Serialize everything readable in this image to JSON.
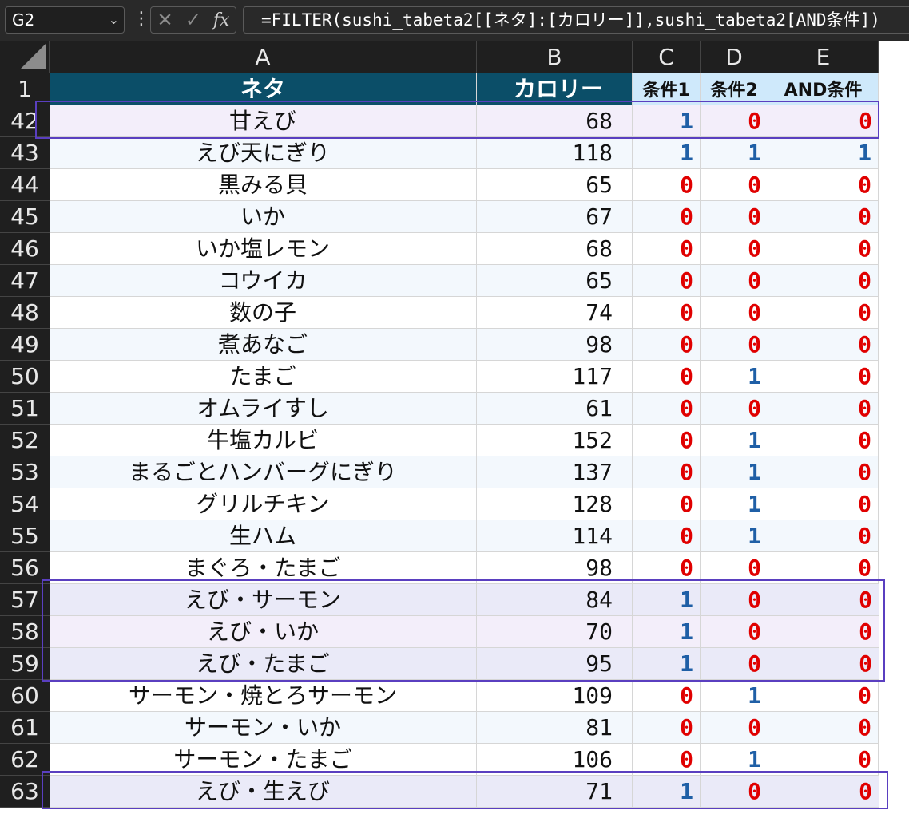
{
  "formula_bar": {
    "name_box": "G2",
    "chevron": "⌄",
    "dots": "⋮",
    "cancel_icon": "✕",
    "enter_icon": "✓",
    "fx_icon": "fx",
    "formula": "=FILTER(sushi_tabeta2[[ネタ]:[カロリー]],sushi_tabeta2[AND条件])"
  },
  "columns": [
    "A",
    "B",
    "C",
    "D",
    "E"
  ],
  "header_row": {
    "row_number": "1",
    "cells": [
      "ネタ",
      "カロリー",
      "条件1",
      "条件2",
      "AND条件"
    ]
  },
  "rows": [
    {
      "row": "42",
      "name": "甘えび",
      "cal": "68",
      "c1": "1",
      "c2": "0",
      "and": "0"
    },
    {
      "row": "43",
      "name": "えび天にぎり",
      "cal": "118",
      "c1": "1",
      "c2": "1",
      "and": "1"
    },
    {
      "row": "44",
      "name": "黒みる貝",
      "cal": "65",
      "c1": "0",
      "c2": "0",
      "and": "0"
    },
    {
      "row": "45",
      "name": "いか",
      "cal": "67",
      "c1": "0",
      "c2": "0",
      "and": "0"
    },
    {
      "row": "46",
      "name": "いか塩レモン",
      "cal": "68",
      "c1": "0",
      "c2": "0",
      "and": "0"
    },
    {
      "row": "47",
      "name": "コウイカ",
      "cal": "65",
      "c1": "0",
      "c2": "0",
      "and": "0"
    },
    {
      "row": "48",
      "name": "数の子",
      "cal": "74",
      "c1": "0",
      "c2": "0",
      "and": "0"
    },
    {
      "row": "49",
      "name": "煮あなご",
      "cal": "98",
      "c1": "0",
      "c2": "0",
      "and": "0"
    },
    {
      "row": "50",
      "name": "たまご",
      "cal": "117",
      "c1": "0",
      "c2": "1",
      "and": "0"
    },
    {
      "row": "51",
      "name": "オムライすし",
      "cal": "61",
      "c1": "0",
      "c2": "0",
      "and": "0"
    },
    {
      "row": "52",
      "name": "牛塩カルビ",
      "cal": "152",
      "c1": "0",
      "c2": "1",
      "and": "0"
    },
    {
      "row": "53",
      "name": "まるごとハンバーグにぎり",
      "cal": "137",
      "c1": "0",
      "c2": "1",
      "and": "0"
    },
    {
      "row": "54",
      "name": "グリルチキン",
      "cal": "128",
      "c1": "0",
      "c2": "1",
      "and": "0"
    },
    {
      "row": "55",
      "name": "生ハム",
      "cal": "114",
      "c1": "0",
      "c2": "1",
      "and": "0"
    },
    {
      "row": "56",
      "name": "まぐろ・たまご",
      "cal": "98",
      "c1": "0",
      "c2": "0",
      "and": "0"
    },
    {
      "row": "57",
      "name": "えび・サーモン",
      "cal": "84",
      "c1": "1",
      "c2": "0",
      "and": "0"
    },
    {
      "row": "58",
      "name": "えび・いか",
      "cal": "70",
      "c1": "1",
      "c2": "0",
      "and": "0"
    },
    {
      "row": "59",
      "name": "えび・たまご",
      "cal": "95",
      "c1": "1",
      "c2": "0",
      "and": "0"
    },
    {
      "row": "60",
      "name": "サーモン・焼とろサーモン",
      "cal": "109",
      "c1": "0",
      "c2": "1",
      "and": "0"
    },
    {
      "row": "61",
      "name": "サーモン・いか",
      "cal": "81",
      "c1": "0",
      "c2": "0",
      "and": "0"
    },
    {
      "row": "62",
      "name": "サーモン・たまご",
      "cal": "106",
      "c1": "0",
      "c2": "1",
      "and": "0"
    },
    {
      "row": "63",
      "name": "えび・生えび",
      "cal": "71",
      "c1": "1",
      "c2": "0",
      "and": "0"
    }
  ],
  "colors": {
    "header_dark": "#0b4e68",
    "header_light": "#cfe9fb",
    "flag_one": "#1f5fa6",
    "flag_zero": "#e00000",
    "highlight_box": "#5a3fc0",
    "band_light": "#f3f8fd",
    "band_purple": "#f3eefa"
  }
}
